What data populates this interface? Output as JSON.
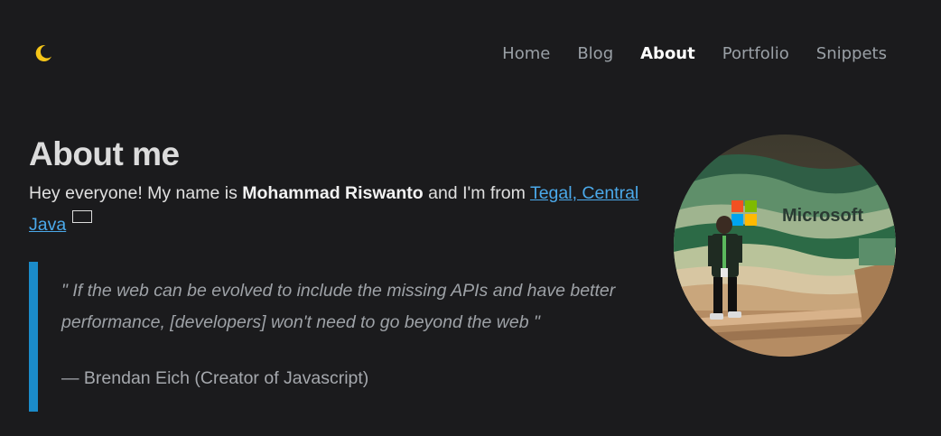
{
  "nav": {
    "theme_toggle_icon": "moon-icon",
    "items": [
      {
        "label": "Home"
      },
      {
        "label": "Blog"
      },
      {
        "label": "About",
        "active": true
      },
      {
        "label": "Portfolio"
      },
      {
        "label": "Snippets"
      }
    ]
  },
  "about": {
    "title": "About me",
    "intro_prefix": "Hey everyone! My name is ",
    "name": "Mohammad Riswanto",
    "intro_middle": " and I'm from ",
    "location_link": "Tegal, Central Java",
    "flag_icon": "indonesia-flag-icon",
    "quote": "\" If the web can be evolved to include the missing APIs and have better performance, [developers] won't need to go beyond the web \"",
    "quote_cite": "— Brendan Eich (Creator of Javascript)",
    "photo_sign_text": "Microsoft"
  },
  "colors": {
    "background": "#1b1b1d",
    "accent_blue": "#1b8bc9",
    "link": "#4ba9ea",
    "moon": "#f5c518"
  }
}
